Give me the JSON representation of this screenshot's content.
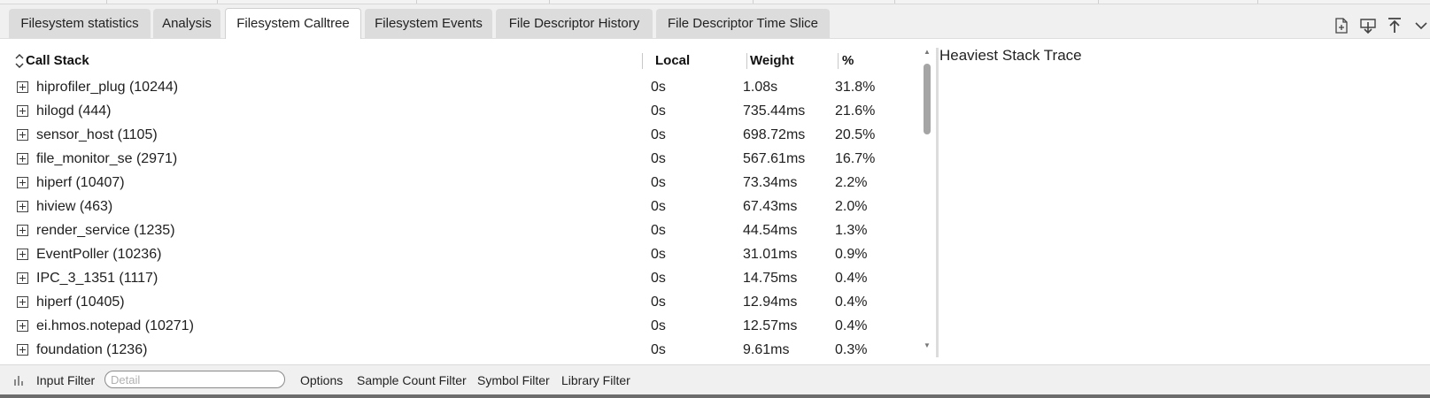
{
  "tabs": [
    {
      "label": "Filesystem statistics",
      "active": false
    },
    {
      "label": "Analysis",
      "active": false
    },
    {
      "label": "Filesystem Calltree",
      "active": true
    },
    {
      "label": "Filesystem Events",
      "active": false
    },
    {
      "label": "File Descriptor History",
      "active": false
    },
    {
      "label": "File Descriptor Time Slice",
      "active": false
    }
  ],
  "toolbar_icons": [
    "export-file-icon",
    "download-icon",
    "move-to-top-icon",
    "chevron-down-icon"
  ],
  "table": {
    "headers": {
      "call_stack": "Call Stack",
      "local": "Local",
      "weight": "Weight",
      "percent": "%"
    },
    "rows": [
      {
        "name": "hiprofiler_plug (10244)",
        "local": "0s",
        "weight": "1.08s",
        "percent": "31.8%"
      },
      {
        "name": "hilogd (444)",
        "local": "0s",
        "weight": "735.44ms",
        "percent": "21.6%"
      },
      {
        "name": "sensor_host (1105)",
        "local": "0s",
        "weight": "698.72ms",
        "percent": "20.5%"
      },
      {
        "name": "file_monitor_se (2971)",
        "local": "0s",
        "weight": "567.61ms",
        "percent": "16.7%"
      },
      {
        "name": "hiperf (10407)",
        "local": "0s",
        "weight": "73.34ms",
        "percent": "2.2%"
      },
      {
        "name": "hiview (463)",
        "local": "0s",
        "weight": "67.43ms",
        "percent": "2.0%"
      },
      {
        "name": "render_service (1235)",
        "local": "0s",
        "weight": "44.54ms",
        "percent": "1.3%"
      },
      {
        "name": "EventPoller (10236)",
        "local": "0s",
        "weight": "31.01ms",
        "percent": "0.9%"
      },
      {
        "name": "IPC_3_1351 (1117)",
        "local": "0s",
        "weight": "14.75ms",
        "percent": "0.4%"
      },
      {
        "name": "hiperf (10405)",
        "local": "0s",
        "weight": "12.94ms",
        "percent": "0.4%"
      },
      {
        "name": "ei.hmos.notepad (10271)",
        "local": "0s",
        "weight": "12.57ms",
        "percent": "0.4%"
      },
      {
        "name": "foundation (1236)",
        "local": "0s",
        "weight": "9.61ms",
        "percent": "0.3%"
      }
    ]
  },
  "right_panel": {
    "title": "Heaviest Stack Trace"
  },
  "bottom": {
    "input_filter_label": "Input Filter",
    "detail_placeholder": "Detail",
    "options_label": "Options",
    "sample_count_filter_label": "Sample Count Filter",
    "symbol_filter_label": "Symbol Filter",
    "library_filter_label": "Library Filter"
  }
}
